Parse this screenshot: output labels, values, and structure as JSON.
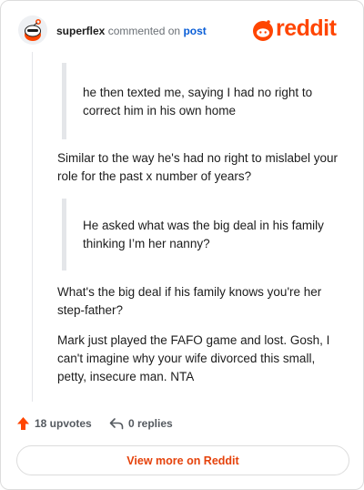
{
  "header": {
    "username": "superflex",
    "action": "commented on",
    "target": "post",
    "brand": "reddit"
  },
  "comment": {
    "quote1": "he then texted me, saying I had no right to correct him in his own home",
    "para1": "Similar to the way he's had no right to mislabel your role for the past x number of years?",
    "quote2": "He asked what was the big deal in his family thinking I’m her nanny?",
    "para2": "What's the big deal if his family knows you're her step-father?",
    "para3": "Mark just played the FAFO game and lost. Gosh, I can't imagine why your wife divorced this small, petty, insecure man. NTA"
  },
  "footer": {
    "upvotes": "18 upvotes",
    "replies": "0 replies",
    "view_more": "View more on Reddit"
  },
  "colors": {
    "brand": "#ff4500",
    "link": "#0a5ed7",
    "upvote": "#ff4500"
  },
  "icons": [
    "snoo-avatar-icon",
    "reddit-logo-icon",
    "upvote-arrow-icon",
    "reply-arrow-icon"
  ]
}
